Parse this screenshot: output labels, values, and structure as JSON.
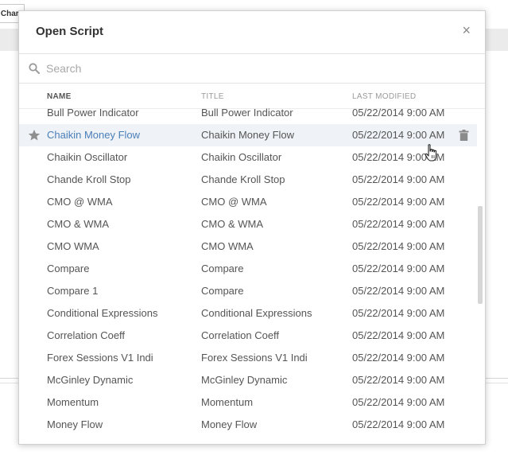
{
  "background": {
    "chart_button_label": "Chart"
  },
  "dialog": {
    "title": "Open Script",
    "close_label": "×",
    "search": {
      "placeholder": "Search",
      "value": ""
    },
    "columns": {
      "name": "NAME",
      "title": "TITLE",
      "last_modified": "LAST MODIFIED"
    },
    "rows": [
      {
        "name": "Bull Power Indicator",
        "title": "Bull Power Indicator",
        "modified": "05/22/2014 9:00 AM"
      },
      {
        "name": "Chaikin Money Flow",
        "title": "Chaikin Money Flow",
        "modified": "05/22/2014 9:00 AM"
      },
      {
        "name": "Chaikin Oscillator",
        "title": "Chaikin Oscillator",
        "modified": "05/22/2014 9:00 AM"
      },
      {
        "name": "Chande Kroll Stop",
        "title": "Chande Kroll Stop",
        "modified": "05/22/2014 9:00 AM"
      },
      {
        "name": "CMO @ WMA",
        "title": "CMO @ WMA",
        "modified": "05/22/2014 9:00 AM"
      },
      {
        "name": "CMO & WMA",
        "title": "CMO & WMA",
        "modified": "05/22/2014 9:00 AM"
      },
      {
        "name": "CMO WMA",
        "title": "CMO WMA",
        "modified": "05/22/2014 9:00 AM"
      },
      {
        "name": "Compare",
        "title": "Compare",
        "modified": "05/22/2014 9:00 AM"
      },
      {
        "name": "Compare 1",
        "title": "Compare",
        "modified": "05/22/2014 9:00 AM"
      },
      {
        "name": "Conditional Expressions",
        "title": "Conditional Expressions",
        "modified": "05/22/2014 9:00 AM"
      },
      {
        "name": "Correlation Coeff",
        "title": "Correlation Coeff",
        "modified": "05/22/2014 9:00 AM"
      },
      {
        "name": "Forex Sessions V1 Indi",
        "title": "Forex Sessions V1 Indi",
        "modified": "05/22/2014 9:00 AM"
      },
      {
        "name": "McGinley Dynamic",
        "title": "McGinley Dynamic",
        "modified": "05/22/2014 9:00 AM"
      },
      {
        "name": "Momentum",
        "title": "Momentum",
        "modified": "05/22/2014 9:00 AM"
      },
      {
        "name": "Money Flow",
        "title": "Money Flow",
        "modified": "05/22/2014 9:00 AM"
      }
    ],
    "selected_row_index": 1,
    "icons": {
      "search": "search-icon",
      "star": "star-icon",
      "trash": "trash-icon",
      "close": "close-icon",
      "cursor": "hand-cursor-icon"
    },
    "colors": {
      "selected_bg": "#eff2f6",
      "selected_text": "#4a7fb8",
      "text": "#555555"
    }
  }
}
